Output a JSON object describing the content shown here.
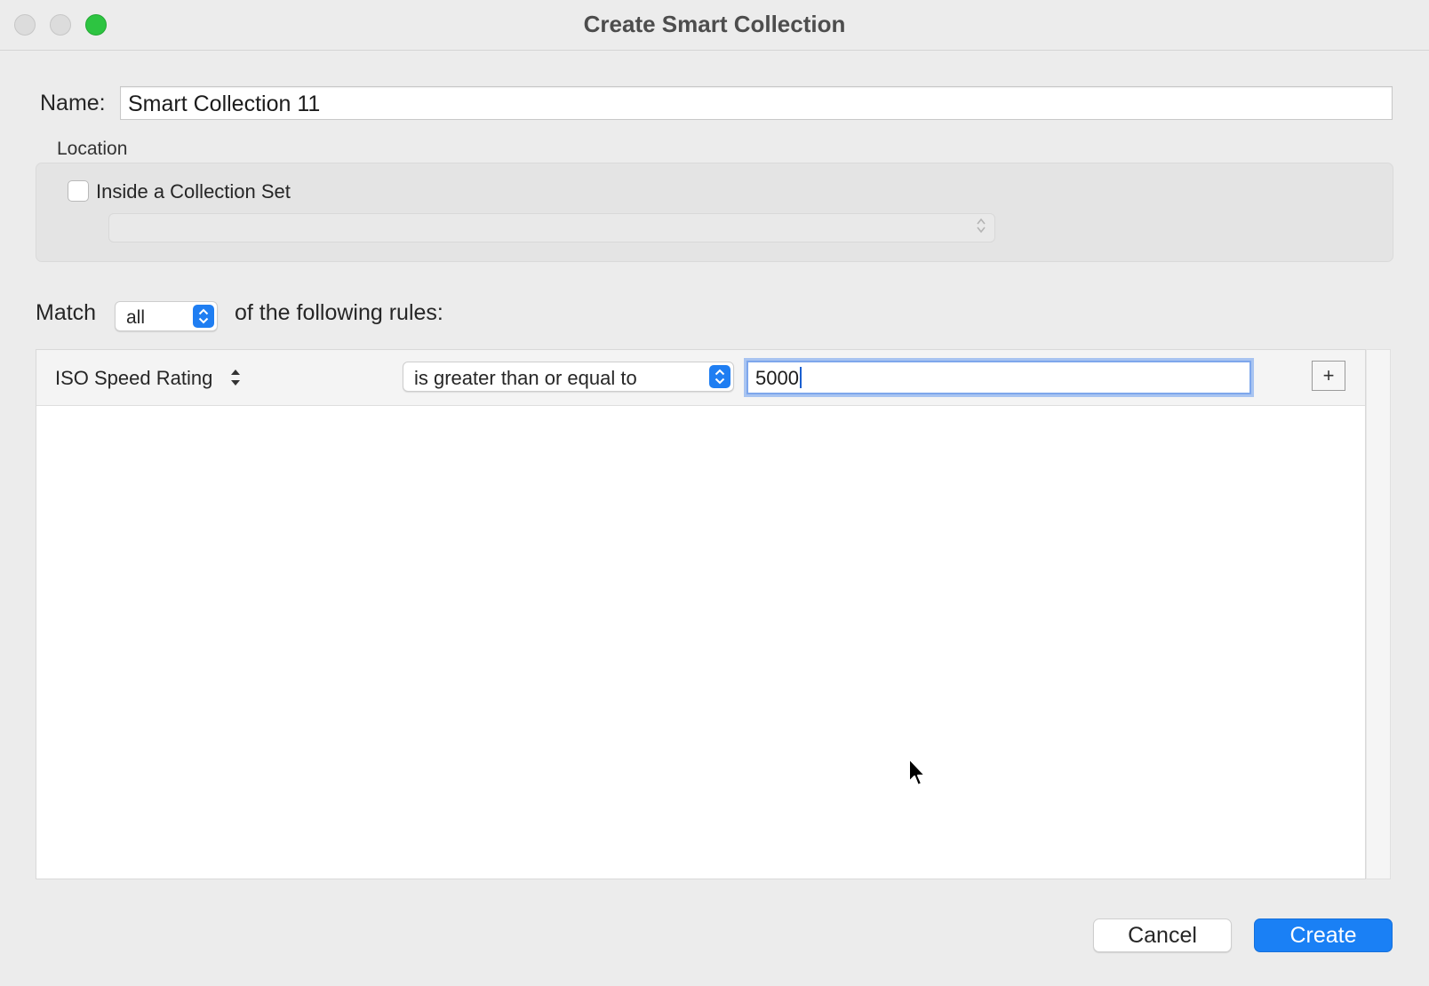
{
  "window": {
    "title": "Create Smart Collection",
    "accent_color": "#1a80f5"
  },
  "name": {
    "label": "Name:",
    "value": "Smart Collection 11"
  },
  "location": {
    "label": "Location",
    "checkbox_label": "Inside a Collection Set",
    "checked": false,
    "collection_set_value": ""
  },
  "match": {
    "prefix": "Match",
    "selected": "all",
    "suffix": "of the following rules:"
  },
  "rules": [
    {
      "field": "ISO Speed Rating",
      "operator": "is greater than or equal to",
      "value": "5000",
      "add_label": "+"
    }
  ],
  "buttons": {
    "cancel": "Cancel",
    "create": "Create"
  },
  "icons": [
    "close-icon",
    "minimize-icon",
    "zoom-icon",
    "updown-chevron-icon",
    "plus-icon",
    "pointer-cursor-icon"
  ]
}
